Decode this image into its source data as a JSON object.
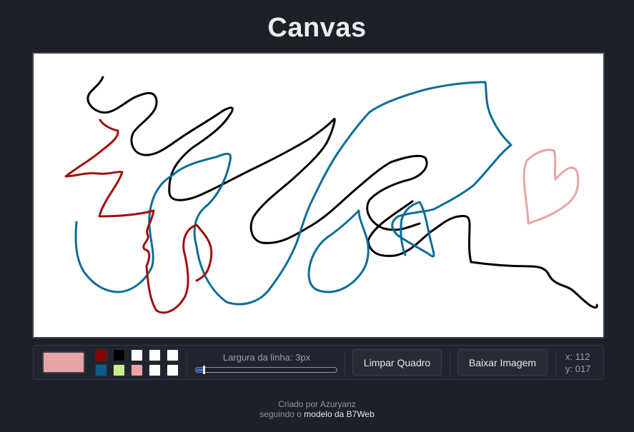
{
  "header": {
    "title": "Canvas"
  },
  "palette": {
    "current_color": "#e8a4a4",
    "swatches": [
      {
        "name": "dark-red",
        "color": "#8b0000"
      },
      {
        "name": "black",
        "color": "#000000"
      },
      {
        "name": "white-1",
        "color": "#ffffff"
      },
      {
        "name": "white-2",
        "color": "#ffffff"
      },
      {
        "name": "white-3",
        "color": "#ffffff"
      },
      {
        "name": "teal-blue",
        "color": "#0b5f87"
      },
      {
        "name": "light-green",
        "color": "#c4f08a"
      },
      {
        "name": "pink",
        "color": "#e8a4a4"
      },
      {
        "name": "white-4",
        "color": "#ffffff"
      },
      {
        "name": "white-5",
        "color": "#ffffff"
      }
    ]
  },
  "line_width": {
    "label": "Largura da linha: 3px",
    "value": 3,
    "min": 1,
    "max": 100
  },
  "buttons": {
    "clear": "Limpar Quadro",
    "download": "Baixar Imagem"
  },
  "coords": {
    "x": "x: 112",
    "y": "y: 017"
  },
  "footer": {
    "line1": "Criado por Azuryanz",
    "line2_prefix": "seguindo o ",
    "line2_link": "modelo da B7Web"
  },
  "strokes": [
    {
      "color": "#000000",
      "label": "black-stroke"
    },
    {
      "color": "#0b6e99",
      "label": "blue-stroke"
    },
    {
      "color": "#a00f0f",
      "label": "red-stroke"
    },
    {
      "color": "#e8a4a4",
      "label": "pink-heart-stroke"
    }
  ]
}
